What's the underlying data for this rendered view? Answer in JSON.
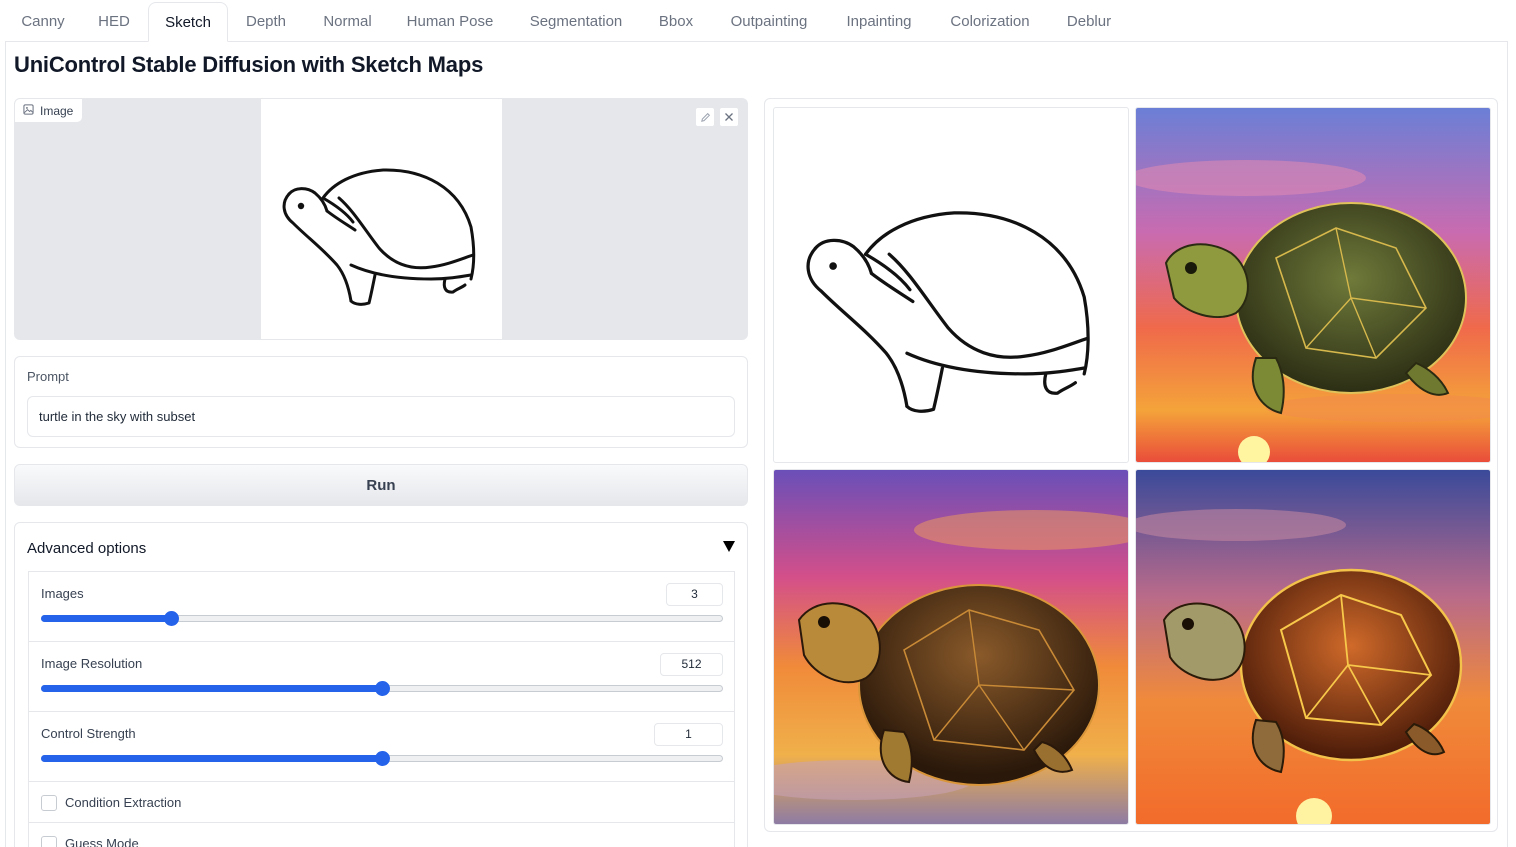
{
  "tabs": [
    {
      "label": "Canny"
    },
    {
      "label": "HED"
    },
    {
      "label": "Sketch",
      "active": true
    },
    {
      "label": "Depth"
    },
    {
      "label": "Normal"
    },
    {
      "label": "Human Pose"
    },
    {
      "label": "Segmentation"
    },
    {
      "label": "Bbox"
    },
    {
      "label": "Outpainting"
    },
    {
      "label": "Inpainting"
    },
    {
      "label": "Colorization"
    },
    {
      "label": "Deblur"
    }
  ],
  "title": "UniControl Stable Diffusion with Sketch Maps",
  "image_input": {
    "label": "Image",
    "icon": "image-icon",
    "tools": [
      "edit-icon",
      "close-icon"
    ]
  },
  "prompt": {
    "label": "Prompt",
    "value": "turtle in the sky with subset"
  },
  "run_label": "Run",
  "advanced": {
    "title": "Advanced options",
    "sliders": [
      {
        "label": "Images",
        "value": "3",
        "fraction": 0.19
      },
      {
        "label": "Image Resolution",
        "value": "512",
        "fraction": 0.5
      },
      {
        "label": "Control Strength",
        "value": "1",
        "fraction": 0.5
      }
    ],
    "checkboxes": [
      {
        "label": "Condition Extraction",
        "checked": false
      },
      {
        "label": "Guess Mode",
        "checked": false
      }
    ]
  },
  "gallery": {
    "items": [
      "control-sketch",
      "result-1",
      "result-2",
      "result-3"
    ]
  },
  "colors": {
    "accent": "#2563eb",
    "border": "#e5e7eb",
    "canvas_bg": "#e5e7eb"
  }
}
